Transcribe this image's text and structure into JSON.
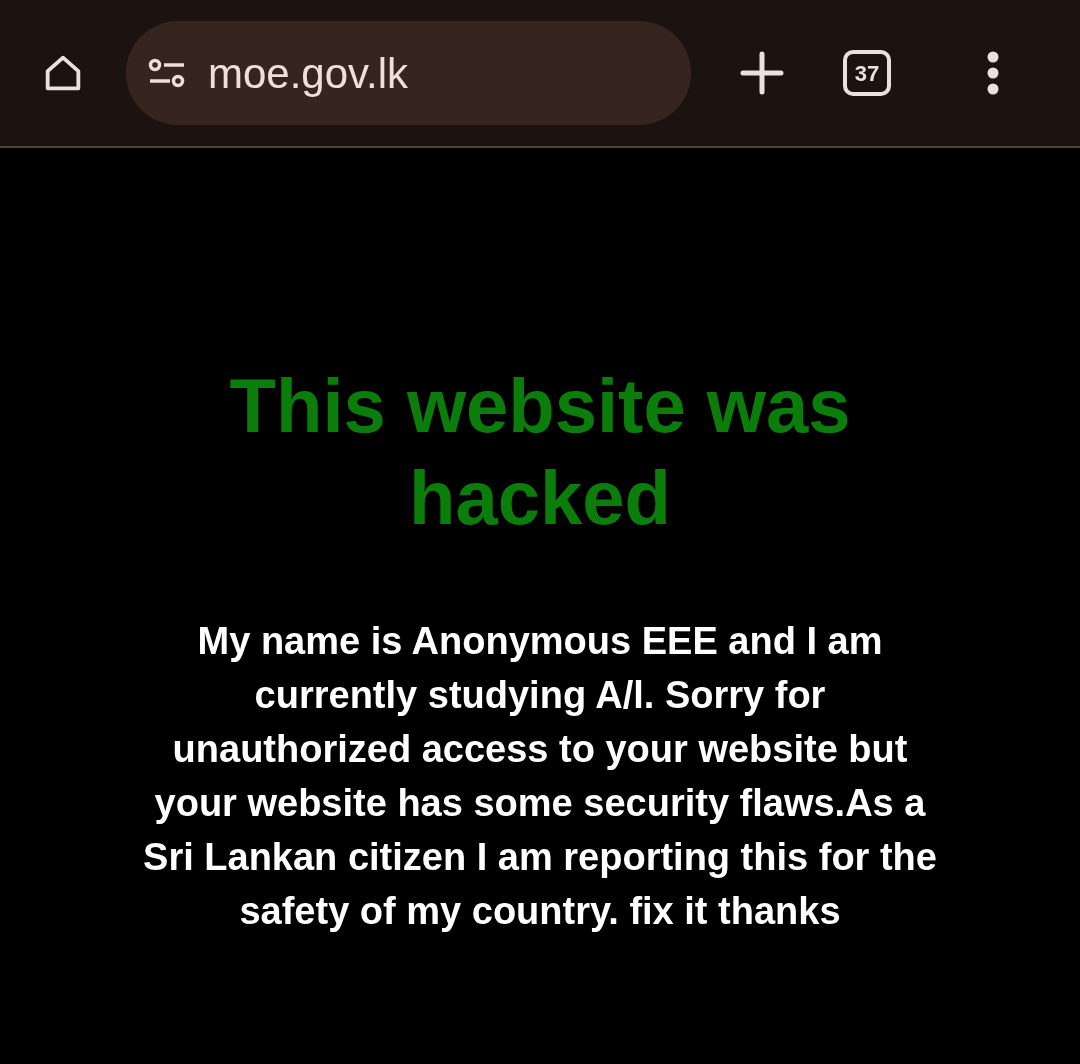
{
  "toolbar": {
    "url": "moe.gov.lk",
    "tab_count": "37"
  },
  "page": {
    "heading": "This website was hacked",
    "message": "My name is Anonymous EEE and I am currently studying A/l. Sorry for unauthorized access to your website but your website has some security flaws.As a Sri Lankan citizen I am reporting this for the safety of my country. fix it thanks"
  }
}
